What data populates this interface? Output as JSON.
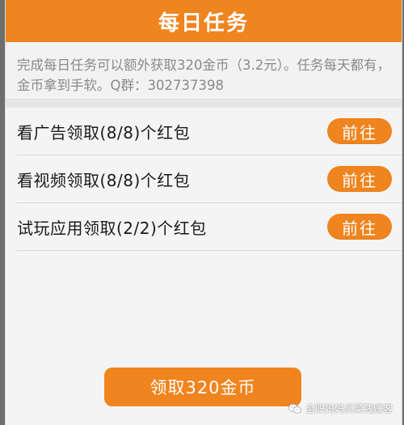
{
  "header": {
    "title": "每日任务"
  },
  "description": {
    "text": "完成每日任务可以额外获取320金币（3.2元）。任务每天都有，金币拿到手软。Q群：302737398"
  },
  "tasks": [
    {
      "label": "看广告领取(8/8)个红包",
      "button": "前往"
    },
    {
      "label": "看视频领取(8/8)个红包",
      "button": "前往"
    },
    {
      "label": "试玩应用领取(2/2)个红包",
      "button": "前往"
    }
  ],
  "claim": {
    "label": "领取320金币"
  },
  "watermark": {
    "icon": "wechat-icon",
    "text": "全职妈妈买菜钱赚客"
  },
  "colors": {
    "accent": "#f0841e",
    "background": "#f4f4f4"
  }
}
